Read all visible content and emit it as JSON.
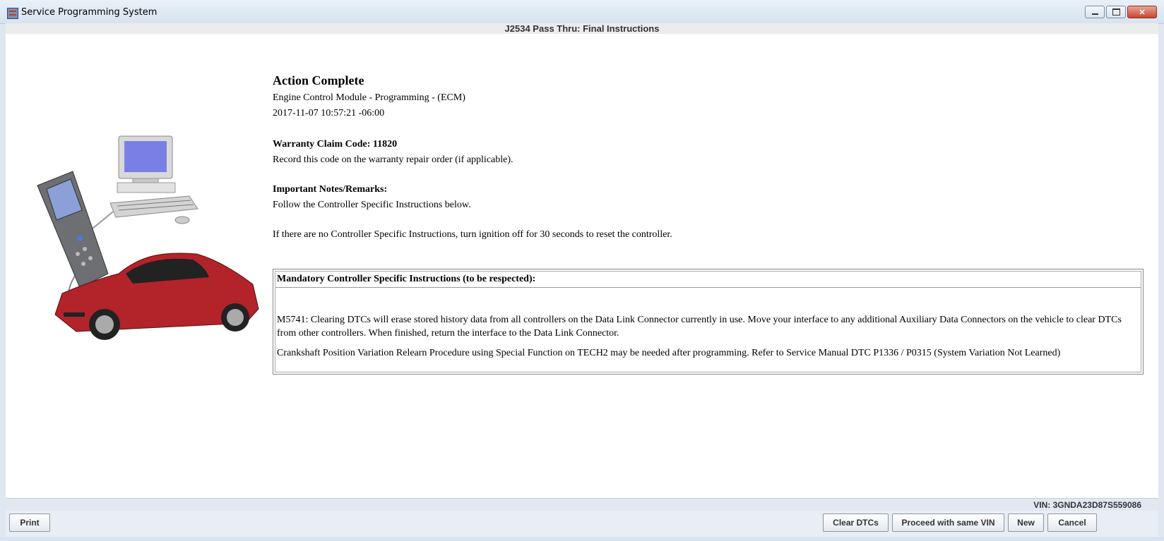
{
  "window": {
    "title": "Service Programming System",
    "subheader": "J2534 Pass Thru:  Final Instructions",
    "close_glyph": "✕"
  },
  "main": {
    "heading": "Action Complete",
    "module": "Engine Control Module - Programming - (ECM)",
    "timestamp": "2017-11-07 10:57:21 -06:00",
    "warranty_label": "Warranty Claim Code: 11820",
    "warranty_note": "Record this code on the warranty repair order (if applicable).",
    "notes_label": "Important Notes/Remarks:",
    "notes_text": "Follow the Controller Specific Instructions below.",
    "ignition_note": "If there are no Controller Specific Instructions, turn ignition off for 30 seconds to reset the controller."
  },
  "instructions": {
    "header": "Mandatory Controller Specific Instructions (to be respected):",
    "items": [
      "M5741: Clearing DTCs will erase stored history data from all controllers on the Data Link Connector currently in use. Move your interface to any additional Auxiliary Data Connectors on the vehicle to clear DTCs from other controllers. When finished, return the interface to the Data Link Connector.",
      "Crankshaft Position Variation Relearn Procedure using Special Function on TECH2 may be needed after programming. Refer to Service Manual DTC P1336 / P0315 (System Variation Not Learned)"
    ]
  },
  "status": {
    "vin": "VIN: 3GNDA23D87S559086"
  },
  "buttons": {
    "print": "Print",
    "clear_dtcs": "Clear DTCs",
    "proceed": "Proceed with same VIN",
    "new": "New",
    "cancel": "Cancel"
  },
  "colors": {
    "car": "#b3232a",
    "frame": "#dfe8f1"
  }
}
